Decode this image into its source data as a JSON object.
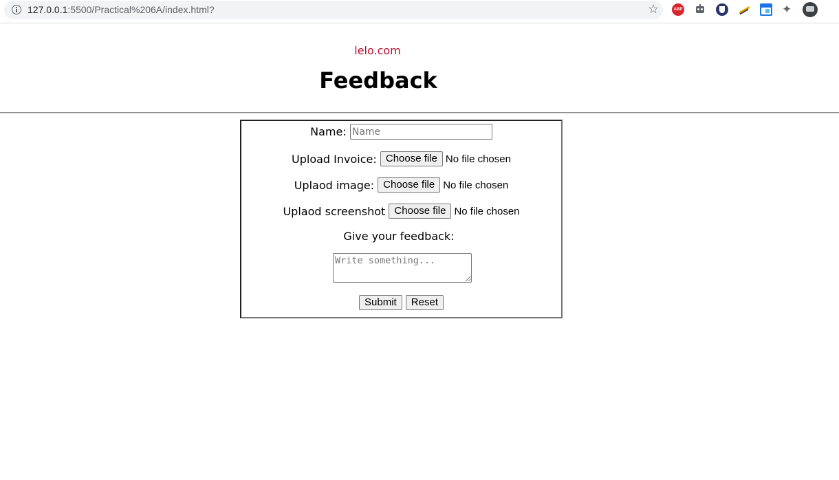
{
  "browser": {
    "url_host": "127.0.0.1",
    "url_rest": ":5500/Practical%206A/index.html?",
    "extensions": [
      "bookmark-star",
      "adblock-plus",
      "robot-extension",
      "shield-extension",
      "pen-extension",
      "window-extension",
      "extensions-puzzle",
      "profile-avatar"
    ],
    "abp_label": "ABP"
  },
  "page": {
    "brand": "lelo.com",
    "title": "Feedback"
  },
  "form": {
    "name_label": "Name:",
    "name_placeholder": "Name",
    "name_value": "",
    "invoice_label": "Upload Invoice:",
    "image_label": "Uplaod image:",
    "screenshot_label": "Uplaod screenshot",
    "choose_file_label": "Choose file",
    "no_file_text": "No file chosen",
    "feedback_label": "Give your feedback:",
    "feedback_placeholder": "Write something...",
    "submit_label": "Submit",
    "reset_label": "Reset"
  },
  "colors": {
    "brand": "#b80f2e",
    "omnibox_bg": "#f1f3f4",
    "button_bg": "#efefef",
    "border": "#767676"
  }
}
